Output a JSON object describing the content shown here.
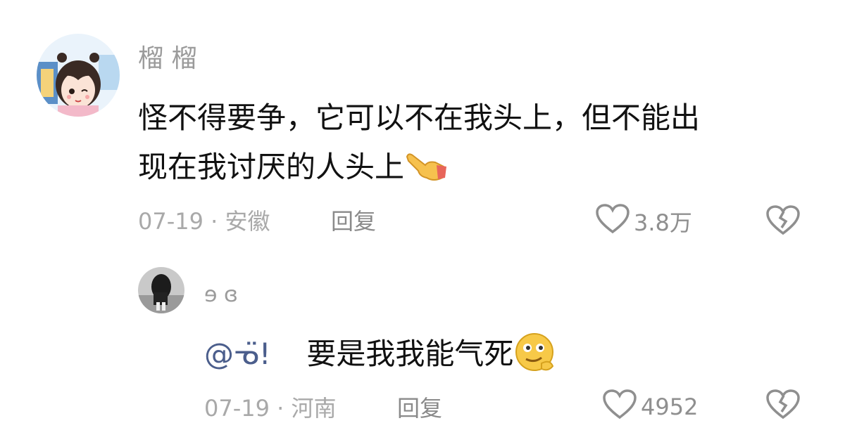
{
  "comments": [
    {
      "username": "榴 榴",
      "text_line1": "怪不得要争，它可以不在我头上，但不能出",
      "text_line2": "现在我讨厌的人头上",
      "emoji_icon": "pointing-finger-icon",
      "date": "07-19",
      "separator": "·",
      "location": "安徽",
      "reply_label": "回复",
      "likes": "3.8万"
    }
  ],
  "replies": [
    {
      "username": "ɘ ɞ",
      "mention": "@ᓀ̈!",
      "text": "要是我我能气死",
      "emoji_icon": "smirk-face-icon",
      "date": "07-19",
      "separator": "·",
      "location": "河南",
      "reply_label": "回复",
      "likes": "4952"
    }
  ],
  "colors": {
    "meta": "#a9a9a9",
    "mention": "#4b5e8c",
    "icon": "#8f8f8f"
  }
}
